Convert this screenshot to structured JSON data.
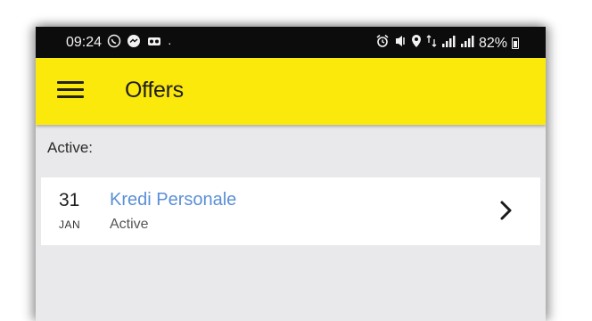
{
  "status_bar": {
    "time": "09:24",
    "left_icons": [
      "whatsapp-icon",
      "messenger-icon",
      "voicemail-icon"
    ],
    "dot": "·",
    "right_icons": [
      "alarm-icon",
      "mute-icon",
      "location-icon",
      "data-icon",
      "signal-icon",
      "signal-icon"
    ],
    "battery": "82%"
  },
  "app_bar": {
    "title": "Offers",
    "background": "#fbe90b"
  },
  "section": {
    "label": "Active:"
  },
  "offers": [
    {
      "day": "31",
      "month": "JAN",
      "title": "Kredi Personale",
      "status": "Active",
      "title_color": "#5b8fd6"
    }
  ]
}
